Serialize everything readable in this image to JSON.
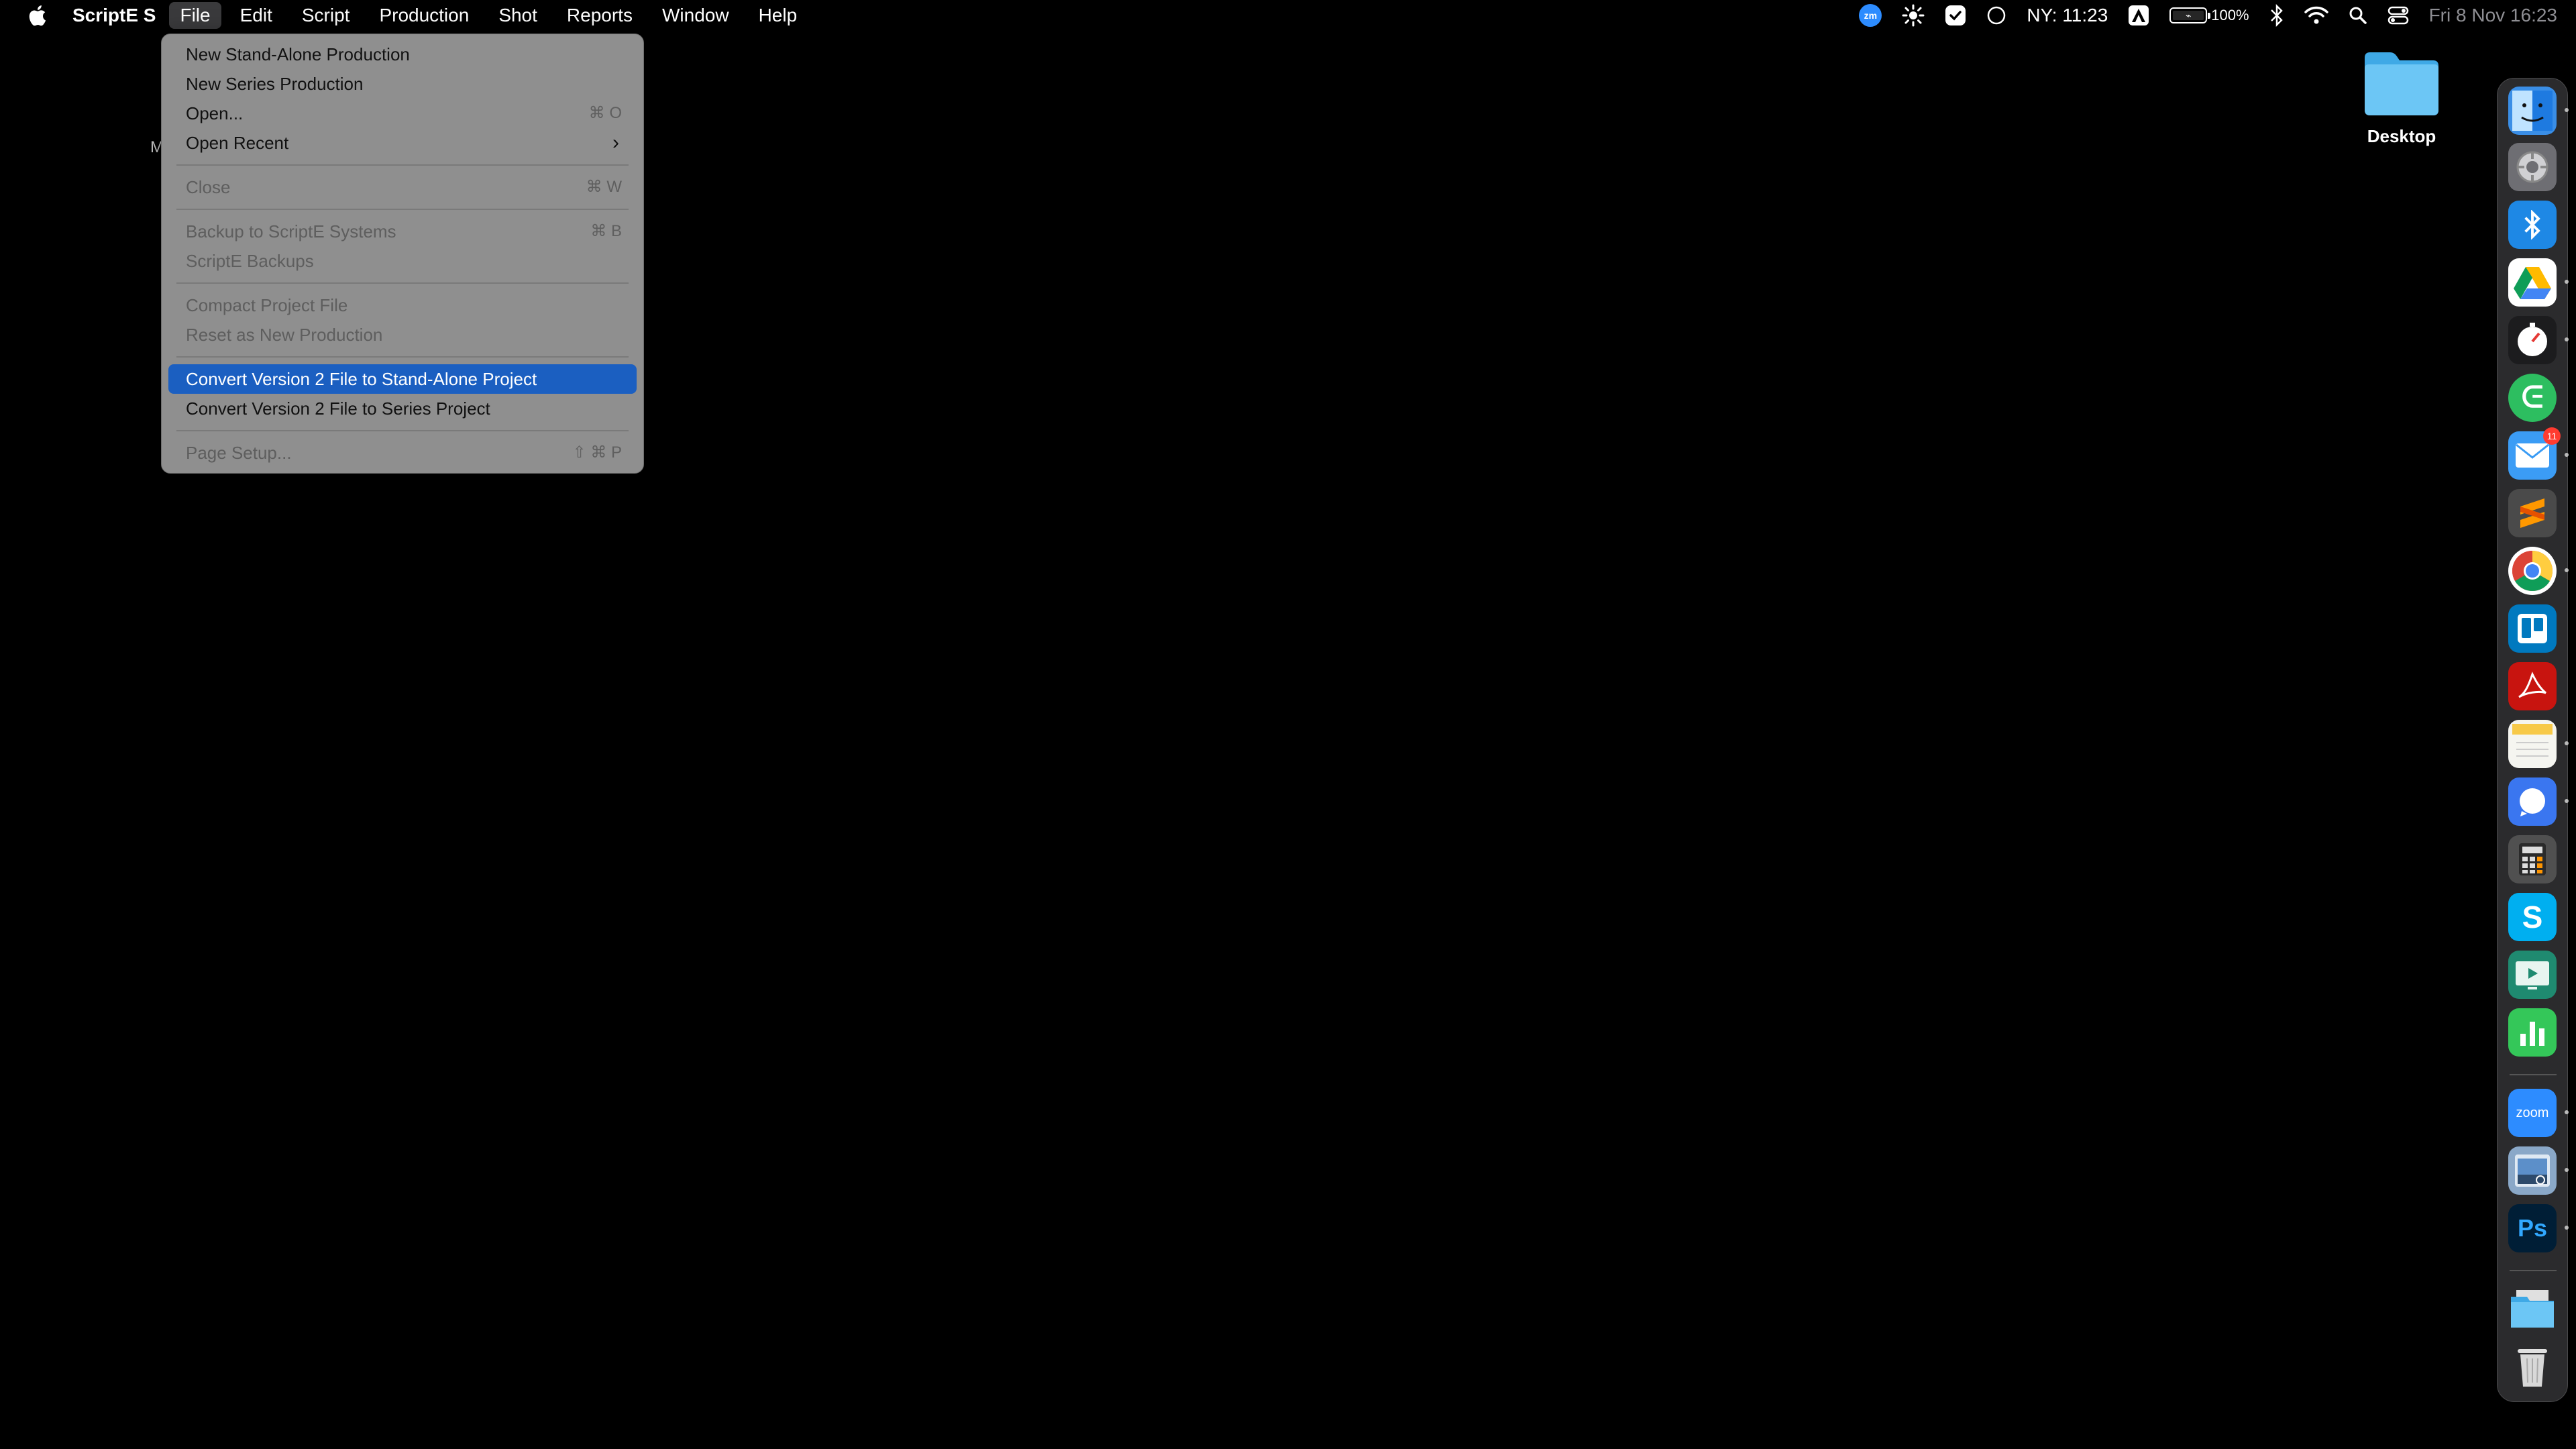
{
  "menubar": {
    "app_name": "ScriptE S",
    "menus": [
      "File",
      "Edit",
      "Script",
      "Production",
      "Shot",
      "Reports",
      "Window",
      "Help"
    ],
    "active_menu": "File",
    "status": {
      "zoom_label": "zm",
      "world_clock": "NY: 11:23",
      "battery_percent": "100%",
      "datetime": "Fri 8 Nov  16:23"
    }
  },
  "file_menu": {
    "items": [
      {
        "label": "New Stand-Alone Production",
        "shortcut": "",
        "enabled": true
      },
      {
        "label": "New Series Production",
        "shortcut": "",
        "enabled": true
      },
      {
        "label": "Open...",
        "shortcut": "⌘ O",
        "enabled": true
      },
      {
        "label": "Open Recent",
        "shortcut": "",
        "enabled": true,
        "submenu": true
      },
      {
        "label": "Close",
        "shortcut": "⌘ W",
        "enabled": false
      },
      {
        "label": "Backup to ScriptE Systems",
        "shortcut": "⌘ B",
        "enabled": false
      },
      {
        "label": "ScriptE Backups",
        "shortcut": "",
        "enabled": false
      },
      {
        "label": "Compact Project File",
        "shortcut": "",
        "enabled": false
      },
      {
        "label": "Reset as New Production",
        "shortcut": "",
        "enabled": false
      },
      {
        "label": "Convert Version 2 File to Stand-Alone Project",
        "shortcut": "",
        "enabled": true,
        "highlighted": true
      },
      {
        "label": "Convert Version 2 File to Series Project",
        "shortcut": "",
        "enabled": true
      },
      {
        "label": "Page Setup...",
        "shortcut": "⇧ ⌘ P",
        "enabled": false
      }
    ],
    "submenu_chevron": "›"
  },
  "desktop": {
    "folder_label": "Desktop",
    "stray_text": "M"
  },
  "dock": {
    "items": [
      {
        "name": "finder",
        "color": "#3a8ee6"
      },
      {
        "name": "system-settings",
        "color": "#6e6e73"
      },
      {
        "name": "bluetooth-file-exchange",
        "color": "#1e88e5"
      },
      {
        "name": "google-drive",
        "color": "#ffffff"
      },
      {
        "name": "timer",
        "color": "#222222"
      },
      {
        "name": "evernote",
        "color": "#2dbe60"
      },
      {
        "name": "mail",
        "color": "#3b9cf5",
        "badge": "11"
      },
      {
        "name": "sublime-text",
        "color": "#4a4a4a"
      },
      {
        "name": "chrome",
        "color": "#ffffff"
      },
      {
        "name": "trello",
        "color": "#0079bf"
      },
      {
        "name": "acrobat",
        "color": "#c8140f"
      },
      {
        "name": "notes",
        "color": "#f5f5f0"
      },
      {
        "name": "signal",
        "color": "#3a76f0"
      },
      {
        "name": "calculator",
        "color": "#505050"
      },
      {
        "name": "skype",
        "color": "#00aff0"
      },
      {
        "name": "keynote-screen",
        "color": "#1f8a70"
      },
      {
        "name": "numbers",
        "color": "#34c759"
      },
      {
        "name": "zoom",
        "color": "#2d8cff",
        "label": "zoom"
      },
      {
        "name": "preview",
        "color": "#8aa8c8"
      },
      {
        "name": "photoshop",
        "color": "#001e36",
        "label": "Ps"
      },
      {
        "name": "downloads-folder",
        "color": "#6ec6f5"
      },
      {
        "name": "trash",
        "color": "#d8d8d8"
      }
    ]
  },
  "colors": {
    "menu_bg": "#8f8f8f",
    "highlight": "#1b5fc1",
    "desktop_bg": "#000000"
  }
}
